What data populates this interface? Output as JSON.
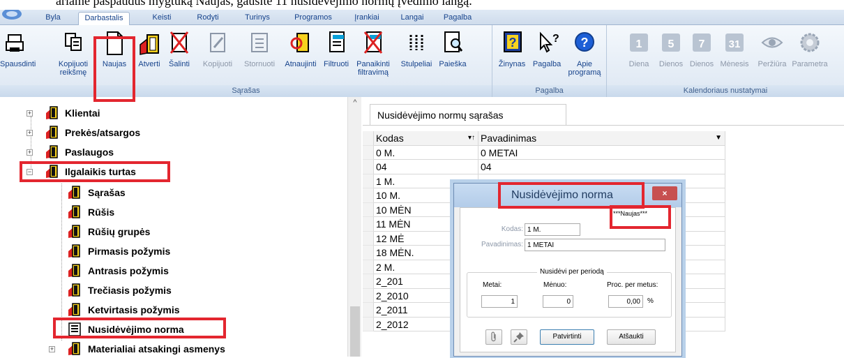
{
  "caption": "ariame paspaudus mygtuką Naujas, gausite 11 nusidėvėjimo normų įvedimo langą.",
  "menu": {
    "tabs": [
      {
        "label": "Byla",
        "active": false
      },
      {
        "label": "Darbastalis",
        "active": true
      },
      {
        "label": "Keisti",
        "active": false
      },
      {
        "label": "Rodyti",
        "active": false
      },
      {
        "label": "Turinys",
        "active": false
      },
      {
        "label": "Programos",
        "active": false
      },
      {
        "label": "Įrankiai",
        "active": false
      },
      {
        "label": "Langai",
        "active": false
      },
      {
        "label": "Pagalba",
        "active": false
      }
    ]
  },
  "ribbon": {
    "sarasas_group_title": "Sąrašas",
    "pagalba_group_title": "Pagalba",
    "kalendorius_group_title": "Kalendoriaus nustatymai",
    "buttons": {
      "spausdinti": "Spausdinti",
      "kopijuoti_reiksme_1": "Kopijuoti",
      "kopijuoti_reiksme_2": "reikšmę",
      "naujas": "Naujas",
      "atverti": "Atverti",
      "salinti": "Šalinti",
      "kopijuoti": "Kopijuoti",
      "stornuoti": "Stornuoti",
      "atnaujinti": "Atnaujinti",
      "filtruoti": "Filtruoti",
      "panaikinti_1": "Panaikinti",
      "panaikinti_2": "filtravimą",
      "stulpeliai": "Stulpeliai",
      "paieska": "Paieška",
      "zinynas": "Žinynas",
      "pagalba": "Pagalba",
      "apie_1": "Apie",
      "apie_2": "programą",
      "diena": "Diena",
      "dienos5": "Dienos",
      "dienos7": "Dienos",
      "menesis": "Mėnesis",
      "perziura": "Peržiūra",
      "parametrai": "Parametra",
      "num_1": "1",
      "num_5": "5",
      "num_7": "7",
      "num_31": "31"
    }
  },
  "tree": {
    "items": [
      {
        "label": "Klientai",
        "expander": "+"
      },
      {
        "label": "Prekės/atsargos",
        "expander": "+"
      },
      {
        "label": "Paslaugos",
        "expander": "+"
      },
      {
        "label": "Ilgalaikis turtas",
        "expander": "−"
      },
      {
        "label": "Sąrašas"
      },
      {
        "label": "Rūšis"
      },
      {
        "label": "Rūšių grupės"
      },
      {
        "label": "Pirmasis požymis"
      },
      {
        "label": "Antrasis požymis"
      },
      {
        "label": "Trečiasis požymis"
      },
      {
        "label": "Ketvirtasis požymis"
      },
      {
        "label": "Nusidėvėjimo norma"
      },
      {
        "label": "Materialiai atsakingi asmenys",
        "expander": "+"
      }
    ],
    "scroll_up": "^"
  },
  "grid": {
    "tab_label": "Nusidėvėjimo normų sąrašas",
    "columns": [
      "Kodas",
      "Pavadinimas"
    ],
    "sort_icon": "▾↑",
    "filter_icon": "▼",
    "rows": [
      [
        "0 M.",
        "0 METAI"
      ],
      [
        "04",
        "04"
      ],
      [
        "1 M.",
        ""
      ],
      [
        "10 M.",
        ""
      ],
      [
        "10 MĖN",
        ""
      ],
      [
        "11 MĖN",
        ""
      ],
      [
        "12 MĖ",
        ""
      ],
      [
        "18 MĖN.",
        ""
      ],
      [
        "2 M.",
        ""
      ],
      [
        "2_201",
        ""
      ],
      [
        "2_2010",
        ""
      ],
      [
        "2_2011",
        ""
      ],
      [
        "2_2012",
        ""
      ]
    ]
  },
  "dialog": {
    "title": "Nusidėvėjimo norma",
    "close": "×",
    "status": "***Naujas***",
    "kodas_label": "Kodas:",
    "kodas_value": "1 M.",
    "pavadinimas_label": "Pavadinimas:",
    "pavadinimas_value": "1 METAI",
    "fieldset_title": "Nusidėvi per periodą",
    "metai_label": "Metai:",
    "metai_value": "1",
    "menuo_label": "Mėnuo:",
    "menuo_value": "0",
    "proc_label": "Proc. per metus:",
    "proc_value": "0,00",
    "proc_unit": "%",
    "confirm_button": "Patvirtinti",
    "cancel_button": "Atšaukti"
  }
}
